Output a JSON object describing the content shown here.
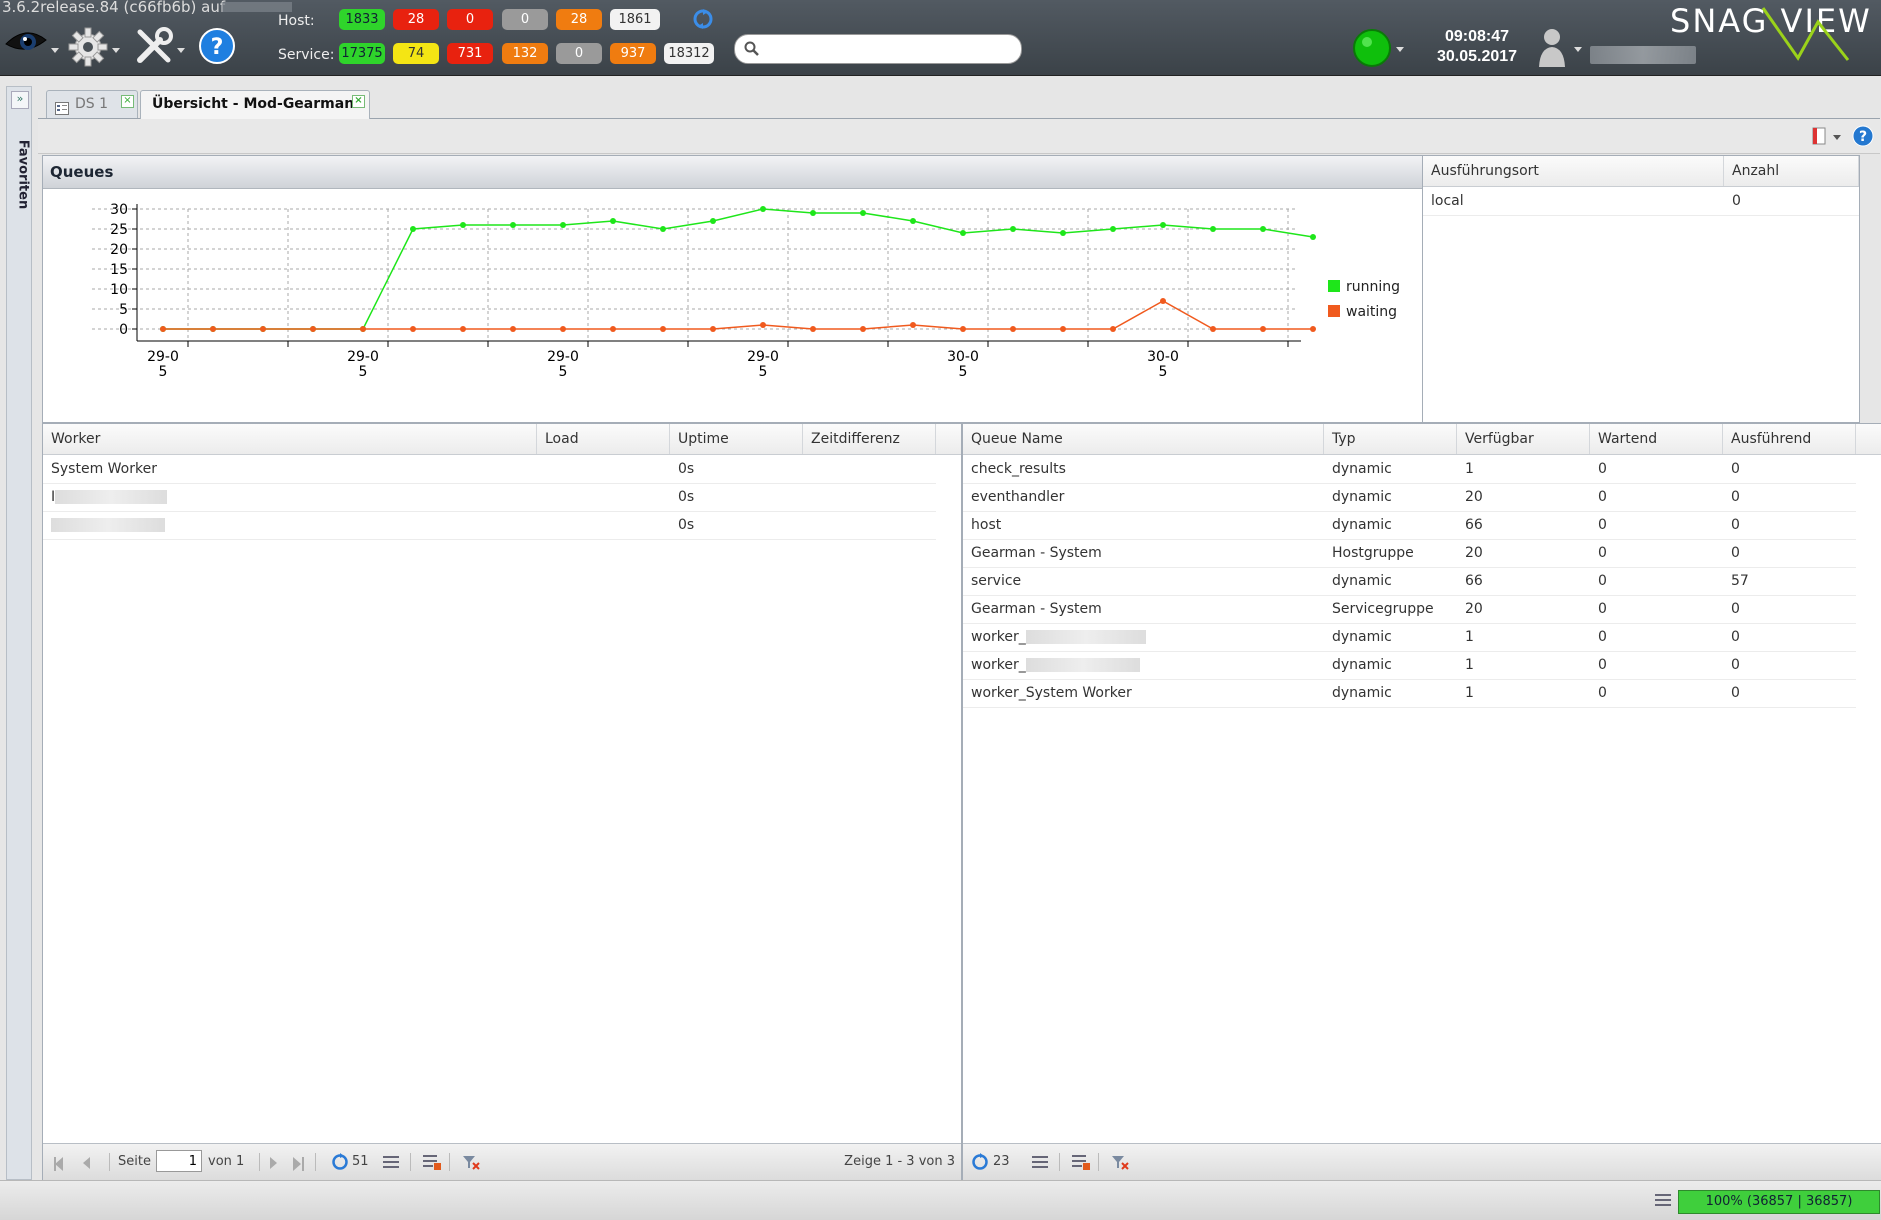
{
  "app": {
    "version": "3.6.2release.84 (c66fb6b) auf"
  },
  "header": {
    "host_label": "Host:",
    "service_label": "Service:",
    "host_counts": [
      {
        "value": "1833",
        "status": "up"
      },
      {
        "value": "28",
        "status": "down"
      },
      {
        "value": "0",
        "status": "unreachable"
      },
      {
        "value": "0",
        "status": "pending"
      },
      {
        "value": "28",
        "status": "ack"
      },
      {
        "value": "1861",
        "status": "total"
      }
    ],
    "service_counts": [
      {
        "value": "17375",
        "status": "ok"
      },
      {
        "value": "74",
        "status": "warning"
      },
      {
        "value": "731",
        "status": "critical"
      },
      {
        "value": "132",
        "status": "unknown"
      },
      {
        "value": "0",
        "status": "pending"
      },
      {
        "value": "937",
        "status": "ack"
      },
      {
        "value": "18312",
        "status": "total"
      }
    ],
    "search": {
      "value": "",
      "placeholder": ""
    },
    "time": "09:08:47",
    "date": "30.05.2017",
    "logo": "SNAG VIEW",
    "colors": {
      "ok": "#2fd42b",
      "critical": "#e8220f",
      "warning": "#f4e514",
      "unknown": "#f07c10",
      "pending": "#9a9a9a"
    }
  },
  "sidebar": {
    "label": "Favoriten"
  },
  "tabs": [
    {
      "label": "DS 1",
      "active": false
    },
    {
      "label": "Übersicht - Mod-Gearman",
      "active": true
    }
  ],
  "queues_panel": {
    "title": "Queues"
  },
  "chart_data": {
    "type": "line",
    "title": "",
    "xlabel": "",
    "ylabel": "",
    "ylim": [
      0,
      30
    ],
    "yticks": [
      0,
      5,
      10,
      15,
      20,
      25,
      30
    ],
    "x_tick_labels": [
      "29-05",
      "29-05",
      "29-05",
      "29-05",
      "30-05",
      "30-05"
    ],
    "grid": true,
    "legend_position": "right",
    "series": [
      {
        "name": "running",
        "color": "#1ee61a",
        "values": [
          0,
          0,
          0,
          0,
          0,
          25,
          26,
          26,
          26,
          27,
          25,
          27,
          30,
          29,
          29,
          27,
          24,
          25,
          24,
          25,
          26,
          25,
          25,
          23
        ]
      },
      {
        "name": "waiting",
        "color": "#f05a1e",
        "values": [
          0,
          0,
          0,
          0,
          0,
          0,
          0,
          0,
          0,
          0,
          0,
          0,
          1,
          0,
          0,
          1,
          0,
          0,
          0,
          0,
          7,
          0,
          0,
          0
        ]
      }
    ]
  },
  "location_grid": {
    "columns": [
      "Ausführungsort",
      "Anzahl"
    ],
    "rows": [
      [
        "local",
        "0"
      ]
    ]
  },
  "worker_grid": {
    "columns": [
      "Worker",
      "Load",
      "Uptime",
      "Zeitdifferenz"
    ],
    "rows": [
      {
        "worker": "System Worker",
        "load": "",
        "uptime": "0s",
        "diff": ""
      },
      {
        "worker": "I",
        "load": "",
        "uptime": "0s",
        "diff": ""
      },
      {
        "worker": "",
        "load": "",
        "uptime": "0s",
        "diff": ""
      }
    ],
    "pager": {
      "page_label": "Seite",
      "page_value": "1",
      "of_label": "von 1",
      "refresh_count": "51",
      "summary": "Zeige 1 - 3 von 3"
    }
  },
  "queue_grid": {
    "columns": [
      "Queue Name",
      "Typ",
      "Verfügbar",
      "Wartend",
      "Ausführend"
    ],
    "rows": [
      {
        "name": "check_results",
        "typ": "dynamic",
        "avail": "1",
        "wait": "0",
        "run": "0"
      },
      {
        "name": "eventhandler",
        "typ": "dynamic",
        "avail": "20",
        "wait": "0",
        "run": "0"
      },
      {
        "name": "host",
        "typ": "dynamic",
        "avail": "66",
        "wait": "0",
        "run": "0"
      },
      {
        "name": "Gearman - System",
        "typ": "Hostgruppe",
        "avail": "20",
        "wait": "0",
        "run": "0"
      },
      {
        "name": "service",
        "typ": "dynamic",
        "avail": "66",
        "wait": "0",
        "run": "57"
      },
      {
        "name": "Gearman - System",
        "typ": "Servicegruppe",
        "avail": "20",
        "wait": "0",
        "run": "0"
      },
      {
        "name": "worker_",
        "typ": "dynamic",
        "avail": "1",
        "wait": "0",
        "run": "0"
      },
      {
        "name": "worker_",
        "typ": "dynamic",
        "avail": "1",
        "wait": "0",
        "run": "0"
      },
      {
        "name": "worker_System Worker",
        "typ": "dynamic",
        "avail": "1",
        "wait": "0",
        "run": "0"
      }
    ],
    "pager": {
      "refresh_count": "23"
    }
  },
  "status_bar": {
    "progress_text": "100% (36857 | 36857)",
    "progress_fraction": 1.0
  }
}
